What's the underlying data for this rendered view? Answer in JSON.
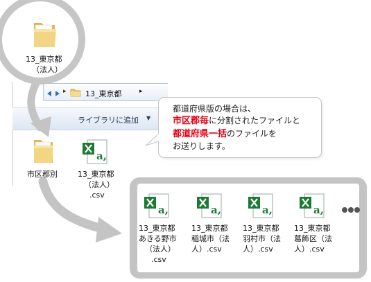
{
  "top_folder": {
    "name_line1": "13_東京都",
    "name_line2": "（法人）",
    "icon": "folder-icon"
  },
  "explorer": {
    "breadcrumb_arrow": "▸",
    "breadcrumb_folder": "13_東京都",
    "breadcrumb_chevron": "▸",
    "toolbar_label": "ライブラリに追加",
    "toolbar_dropdown": "▼",
    "items": [
      {
        "name": "市区郡別",
        "icon": "folder-icon"
      },
      {
        "name_line1": "13_東京都",
        "name_line2": "（法人）",
        "name_line3": ".csv",
        "icon": "excel-csv-icon"
      }
    ]
  },
  "bubble": {
    "line1": "都道府県版の場合は、",
    "line2_red": "市区郡毎",
    "line2_rest": "に分割されたファイルと",
    "line3_red": "都道府県一括",
    "line3_rest": "のファイルを",
    "line4": "お送りします。"
  },
  "panel": {
    "files": [
      {
        "l1": "13_東京都",
        "l2": "あきる野市",
        "l3": "（法人）",
        "l4": ".csv",
        "icon": "excel-csv-icon"
      },
      {
        "l1": "13_東京都",
        "l2": "稲城市（法",
        "l3": "人）.csv",
        "icon": "excel-csv-icon"
      },
      {
        "l1": "13_東京都",
        "l2": "羽村市（法",
        "l3": "人）.csv",
        "icon": "excel-csv-icon"
      },
      {
        "l1": "13_東京都",
        "l2": "葛飾区（法",
        "l3": "人）.csv",
        "icon": "excel-csv-icon"
      }
    ],
    "more_icon": "ellipsis-icon"
  },
  "colors": {
    "ring": "#c6c6c6",
    "arrow": "#c4c4c4",
    "highlight_red": "#e60012",
    "excel_green": "#1d7a35",
    "folder_yellow": "#f1d27a"
  }
}
